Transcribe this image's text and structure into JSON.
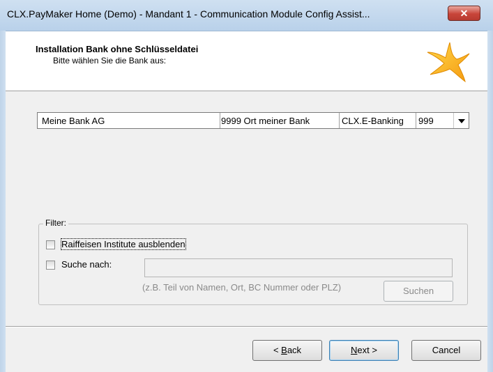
{
  "window": {
    "title": "CLX.PayMaker Home (Demo) - Mandant 1 - Communication Module Config Assist...",
    "close_glyph": "✕"
  },
  "header": {
    "title": "Installation Bank ohne Schlüsseldatei",
    "subtitle": "Bitte wählen Sie die Bank aus:",
    "logo_icon": "star-icon"
  },
  "bank_select": {
    "name": "Meine Bank AG",
    "location": "9999 Ort meiner Bank",
    "type": "CLX.E-Banking",
    "code": "999"
  },
  "filter": {
    "legend": "Filter:",
    "raiffeisen_label": "Raiffeisen Institute ausblenden",
    "raiffeisen_checked": false,
    "search_label": "Suche nach:",
    "search_checked": false,
    "search_value": "",
    "hint": "(z.B. Teil von Namen, Ort, BC Nummer oder PLZ)",
    "search_button": "Suchen"
  },
  "footer": {
    "back_pre": "< ",
    "back_mnemonic": "B",
    "back_post": "ack",
    "next_mnemonic": "N",
    "next_post": "ext >",
    "cancel": "Cancel"
  }
}
